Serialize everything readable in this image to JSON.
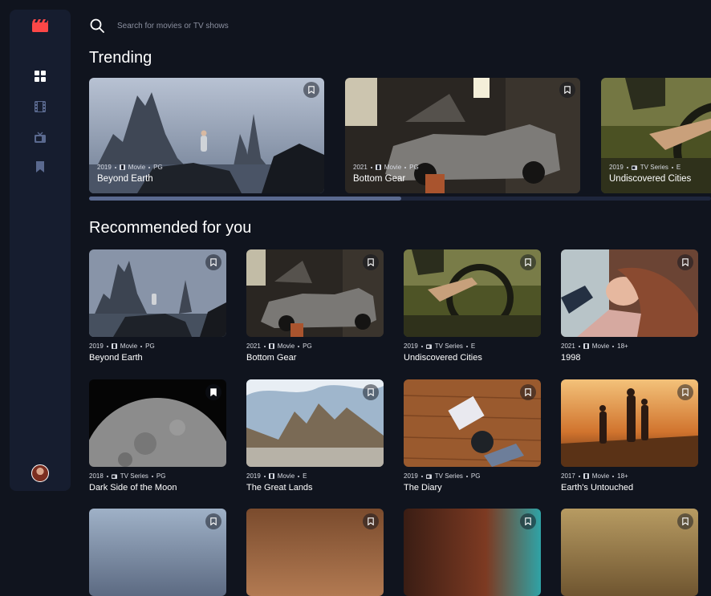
{
  "search": {
    "placeholder": "Search for movies or TV shows"
  },
  "nav": {
    "logo_icon": "film-slate-icon",
    "items": [
      {
        "name": "home",
        "icon": "grid-icon",
        "active": true
      },
      {
        "name": "movies",
        "icon": "film-icon"
      },
      {
        "name": "tv-series",
        "icon": "tv-icon"
      },
      {
        "name": "bookmarks",
        "icon": "bookmark-icon"
      }
    ]
  },
  "colors": {
    "background": "#10141E",
    "sidebar": "#161D2F",
    "accent": "#FC4747",
    "muted": "#5A698F"
  },
  "trending": {
    "title": "Trending",
    "items": [
      {
        "year": "2019",
        "category": "Movie",
        "rating": "PG",
        "title": "Beyond Earth"
      },
      {
        "year": "2021",
        "category": "Movie",
        "rating": "PG",
        "title": "Bottom Gear"
      },
      {
        "year": "2019",
        "category": "TV Series",
        "rating": "E",
        "title": "Undiscovered Cities"
      }
    ]
  },
  "recommended": {
    "title": "Recommended for you",
    "items": [
      {
        "year": "2019",
        "category": "Movie",
        "rating": "PG",
        "title": "Beyond Earth"
      },
      {
        "year": "2021",
        "category": "Movie",
        "rating": "PG",
        "title": "Bottom Gear"
      },
      {
        "year": "2019",
        "category": "TV Series",
        "rating": "E",
        "title": "Undiscovered Cities"
      },
      {
        "year": "2021",
        "category": "Movie",
        "rating": "18+",
        "title": "1998"
      },
      {
        "year": "2018",
        "category": "TV Series",
        "rating": "PG",
        "title": "Dark Side of the Moon"
      },
      {
        "year": "2019",
        "category": "Movie",
        "rating": "E",
        "title": "The Great Lands"
      },
      {
        "year": "2019",
        "category": "TV Series",
        "rating": "PG",
        "title": "The Diary"
      },
      {
        "year": "2017",
        "category": "Movie",
        "rating": "18+",
        "title": "Earth's Untouched"
      }
    ]
  }
}
